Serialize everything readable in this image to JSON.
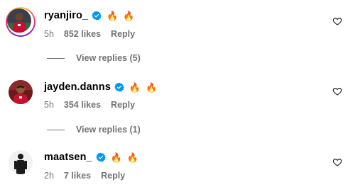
{
  "comments": [
    {
      "username": "ryanjiro_",
      "verified": true,
      "emojis": [
        "🔥",
        "🔥"
      ],
      "time": "5h",
      "likes": "852 likes",
      "reply_label": "Reply",
      "has_story_ring": true,
      "view_replies": "View replies (5)",
      "avatar_icon": "player-red-kit-avatar"
    },
    {
      "username": "jayden.danns",
      "verified": true,
      "emojis": [
        "🔥",
        "🔥"
      ],
      "time": "5h",
      "likes": "354 likes",
      "reply_label": "Reply",
      "has_story_ring": false,
      "view_replies": "View replies (1)",
      "avatar_icon": "player-red-kit-avatar"
    },
    {
      "username": "maatsen_",
      "verified": true,
      "emojis": [
        "🔥",
        "🔥"
      ],
      "time": "2h",
      "likes": "7 likes",
      "reply_label": "Reply",
      "has_story_ring": false,
      "view_replies": null,
      "avatar_icon": "silhouette-figure-avatar"
    }
  ],
  "colors": {
    "verified_blue": "#0095f6",
    "secondary_text": "#737373",
    "fire_orange": "#ff6d00",
    "fire_yellow": "#ffc400"
  }
}
